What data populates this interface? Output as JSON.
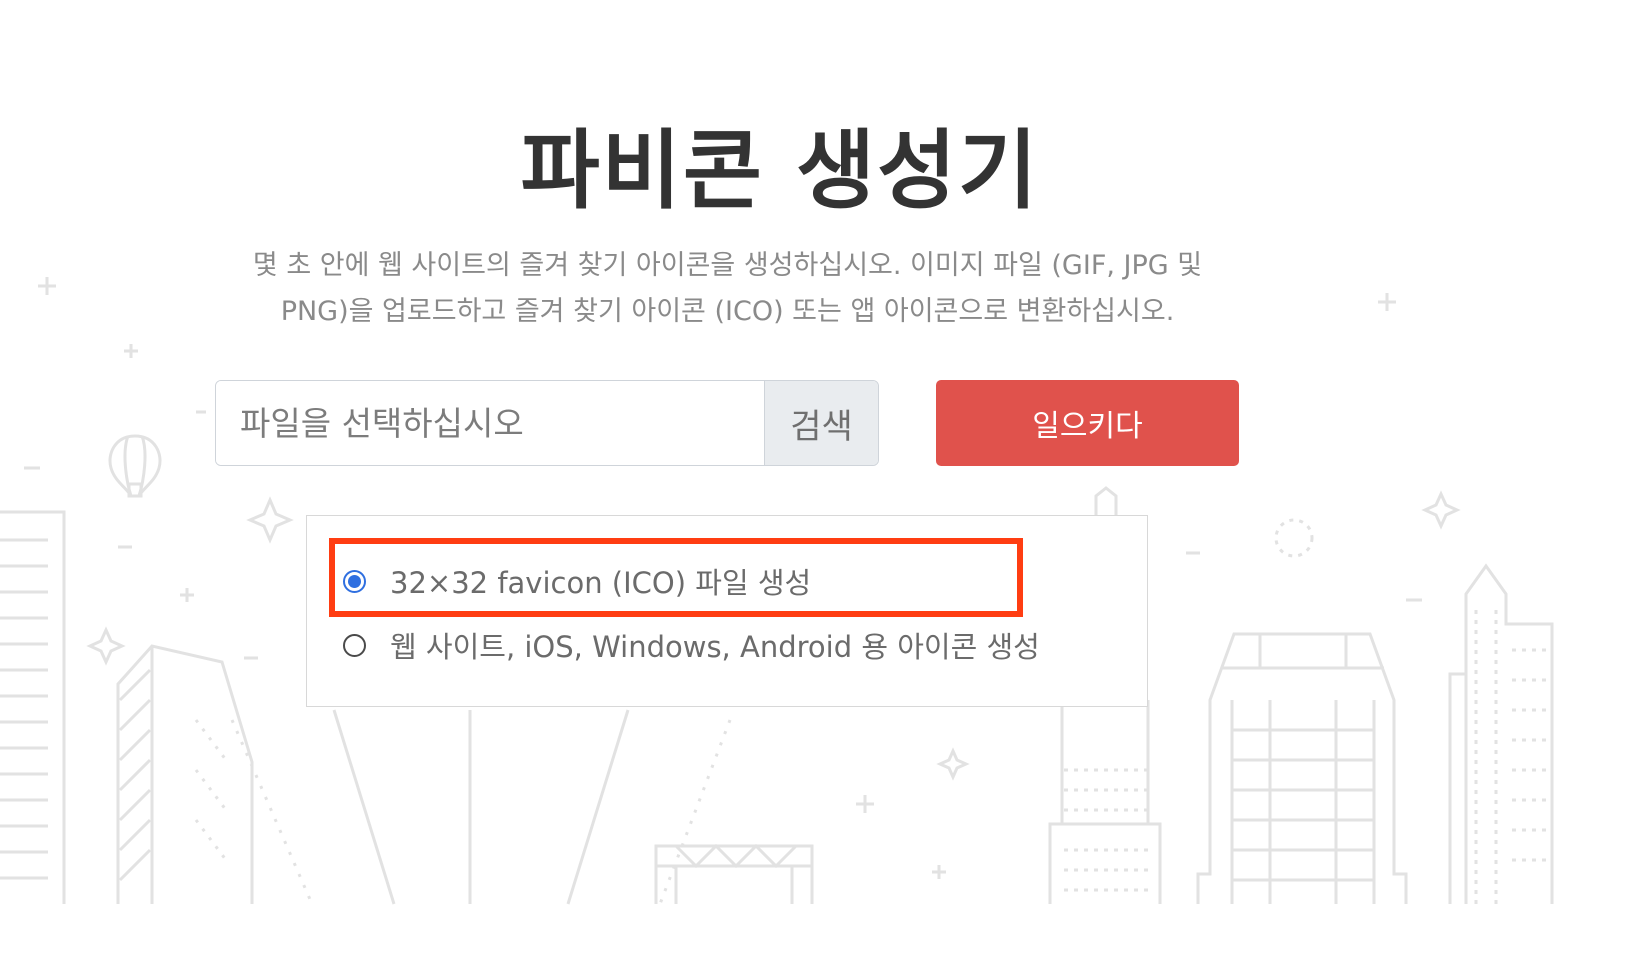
{
  "header": {
    "title": "파비콘 생성기",
    "description_line1": "몇 초 안에 웹 사이트의 즐겨 찾기 아이콘을 생성하십시오. 이미지 파일 (GIF, JPG 및",
    "description_line2": "PNG)을 업로드하고 즐겨 찾기 아이콘 (ICO) 또는 앱 아이콘으로 변환하십시오."
  },
  "upload": {
    "placeholder": "파일을 선택하십시오",
    "browse_label": "검색",
    "submit_label": "일으키다"
  },
  "options": {
    "items": [
      {
        "label": "32×32 favicon (ICO) 파일 생성",
        "selected": true
      },
      {
        "label": "웹 사이트, iOS, Windows, Android 용 아이콘 생성",
        "selected": false
      }
    ]
  },
  "colors": {
    "submit_bg": "#e0524c",
    "highlight": "#ff3d12",
    "radio_selected": "#2f6fe0",
    "background_art": "#e3e3e3"
  }
}
